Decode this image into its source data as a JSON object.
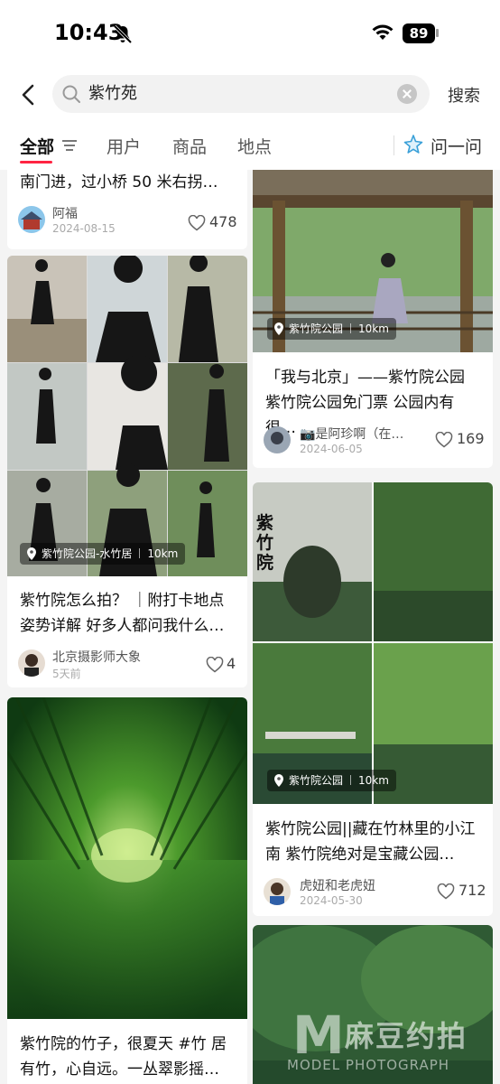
{
  "status": {
    "time": "10:43",
    "battery": "89"
  },
  "search": {
    "query": "紫竹苑",
    "button_label": "搜索"
  },
  "tabs": {
    "all": "全部",
    "users": "用户",
    "products": "商品",
    "places": "地点",
    "ask": "问一问"
  },
  "colors": {
    "accent": "#ff2442",
    "page_bg": "#f4f4f4"
  },
  "icons": {
    "back": "chevron-left-icon",
    "search": "search-icon",
    "clear": "clear-icon",
    "filter": "filter-icon",
    "ask": "ai-sparkle-icon",
    "like": "heart-icon",
    "location": "location-pin-icon"
  },
  "left_column": [
    {
      "title": "南门进，过小桥 50 米右拐…",
      "author": "阿福",
      "date": "2024-08-15",
      "likes": "478"
    },
    {
      "location": "紫竹院公园-水竹居",
      "distance": "10km",
      "title": "紫竹院怎么拍？ ｜附打卡地点姿势详解 好多人都问我什么…",
      "author": "北京摄影师大象",
      "date": "5天前",
      "likes": "4"
    },
    {
      "title": "紫竹院的竹子，很夏天 #竹 居有竹，心自远。一丛翠影摇…"
    }
  ],
  "right_column": [
    {
      "location": "紫竹院公园",
      "distance": "10km",
      "title": "「我与北京」——紫竹院公园 紫竹院公园免门票 公园内有很…",
      "author": "📷是阿珍啊（在…",
      "date": "2024-06-05",
      "likes": "169"
    },
    {
      "sign_text": "紫竹院",
      "location": "紫竹院公园",
      "distance": "10km",
      "title": "紫竹院公园||藏在竹林里的小江南 紫竹院绝对是宝藏公园…",
      "author": "虎妞和老虎妞",
      "date": "2024-05-30",
      "likes": "712"
    }
  ],
  "watermark": {
    "logo": "M",
    "brand": "麻豆约拍",
    "tagline": "MODEL PHOTOGRAPH"
  }
}
